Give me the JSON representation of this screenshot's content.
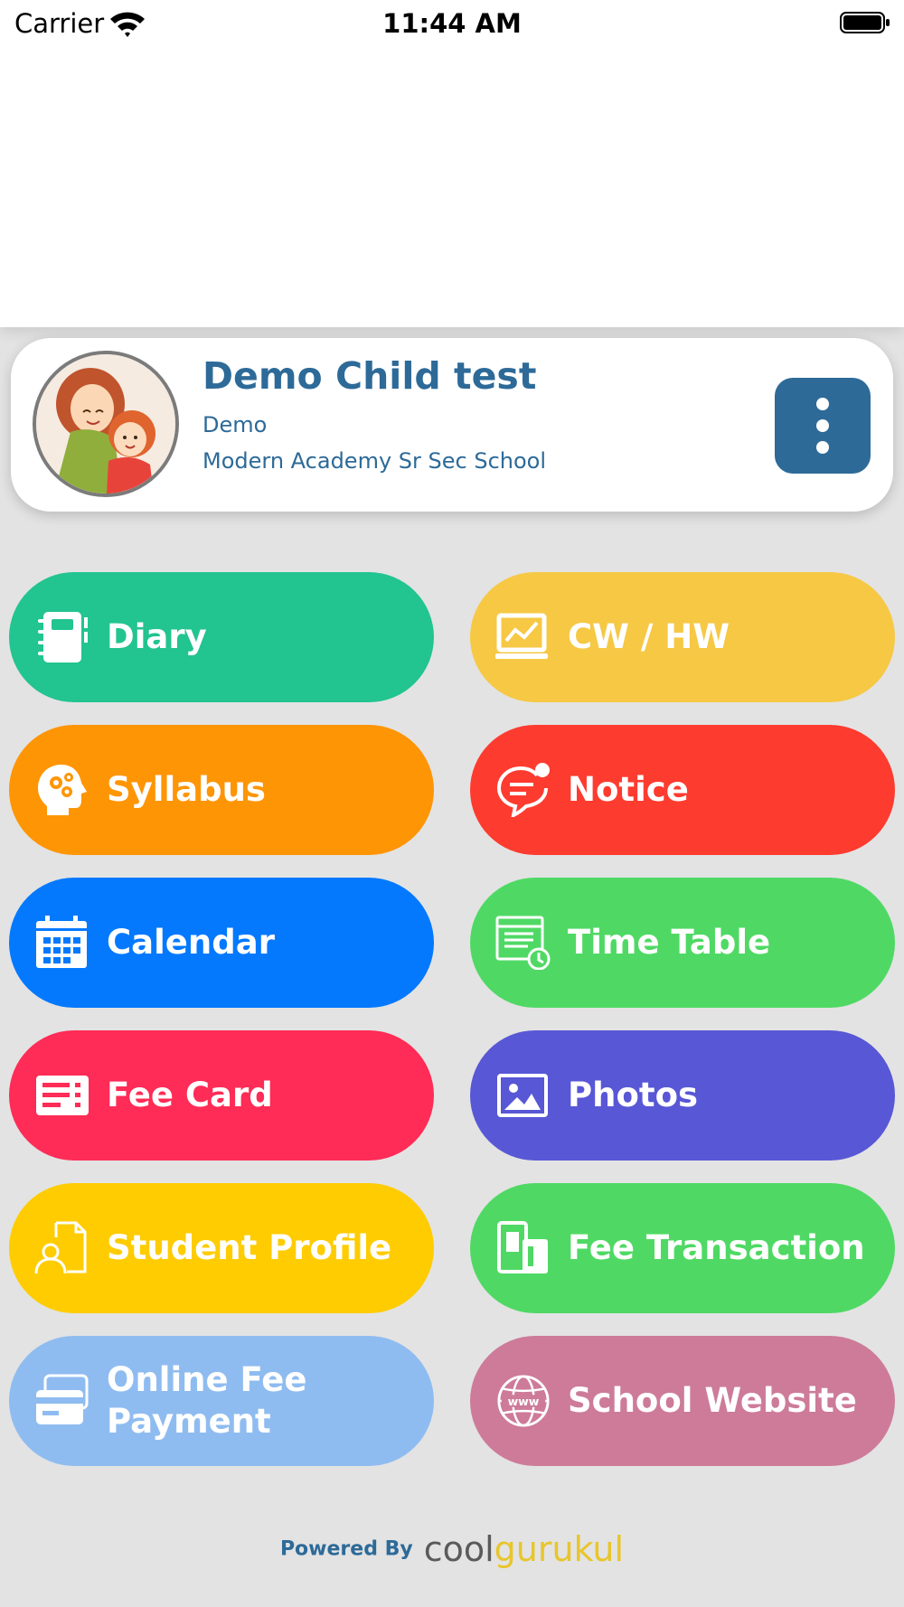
{
  "status_bar": {
    "carrier": "Carrier",
    "time": "11:44 AM"
  },
  "profile": {
    "name": "Demo Child test",
    "class": "Demo",
    "school": "Modern Academy Sr Sec School"
  },
  "tiles": [
    {
      "label": "Diary",
      "icon": "diary-icon",
      "color": "#22c48f"
    },
    {
      "label": "CW / HW",
      "icon": "chart-board-icon",
      "color": "#f6c844"
    },
    {
      "label": "Syllabus",
      "icon": "head-gears-icon",
      "color": "#fe9505"
    },
    {
      "label": "Notice",
      "icon": "chat-bubble-icon",
      "color": "#fe3b2f"
    },
    {
      "label": "Calendar",
      "icon": "calendar-icon",
      "color": "#0479fe"
    },
    {
      "label": "Time Table",
      "icon": "timetable-clock-icon",
      "color": "#4fd964"
    },
    {
      "label": "Fee Card",
      "icon": "fee-card-icon",
      "color": "#fe2c56"
    },
    {
      "label": "Photos",
      "icon": "photo-icon",
      "color": "#5857d6"
    },
    {
      "label": "Student Profile",
      "icon": "student-profile-icon",
      "color": "#fecc01"
    },
    {
      "label": "Fee Transaction",
      "icon": "fee-transaction-icon",
      "color": "#4fd964"
    },
    {
      "label": "Online Fee\nPayment",
      "icon": "credit-card-icon",
      "color": "#8fbcf0"
    },
    {
      "label": "School Website",
      "icon": "globe-www-icon",
      "color": "#cd7b99"
    }
  ],
  "footer": {
    "powered_by": "Powered By",
    "brand_a": "cool",
    "brand_b": "gurukul"
  }
}
